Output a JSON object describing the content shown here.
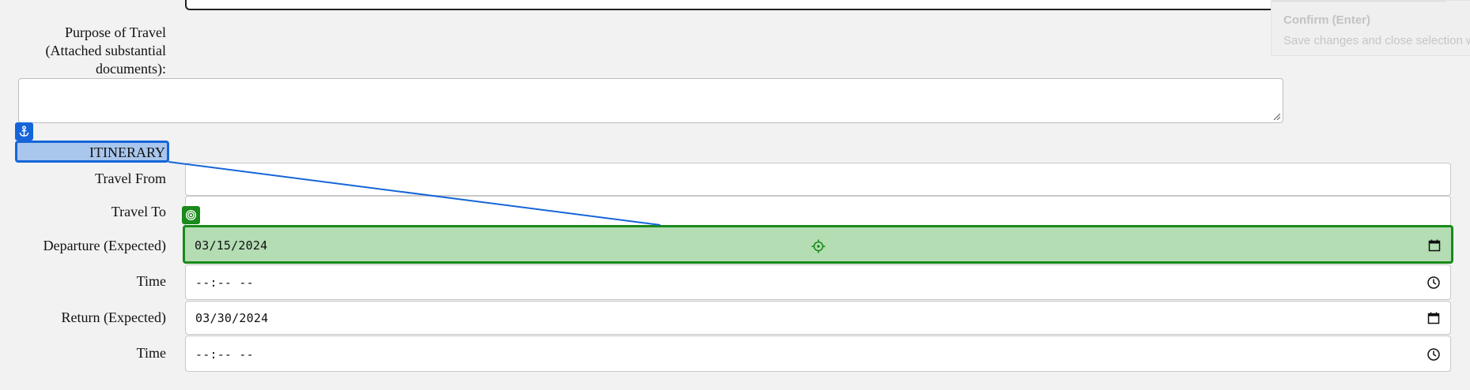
{
  "tooltip": {
    "title": "Confirm (Enter)",
    "description": "Save changes and close selection wi"
  },
  "purpose": {
    "label_line1": "Purpose of Travel",
    "label_line2": "(Attached substantial",
    "label_line3": "documents):",
    "value": ""
  },
  "itinerary": {
    "heading": "ITINERARY",
    "travel_from_label": "Travel From",
    "travel_from_value": "",
    "travel_to_label": "Travel To",
    "travel_to_value": "",
    "departure_label": "Departure (Expected)",
    "departure_value": "03/15/2024",
    "departure_time_label": "Time",
    "departure_time_value": "--:-- --",
    "return_label": "Return (Expected)",
    "return_value": "03/30/2024",
    "return_time_label": "Time",
    "return_time_value": "--:-- --"
  },
  "overlay": {
    "anchor_badge_icon": "anchor-icon",
    "target_badge_icon": "target-icon",
    "crosshair_icon": "crosshair-icon",
    "source_color": "#1565d8",
    "target_color": "#1a8a1a"
  }
}
